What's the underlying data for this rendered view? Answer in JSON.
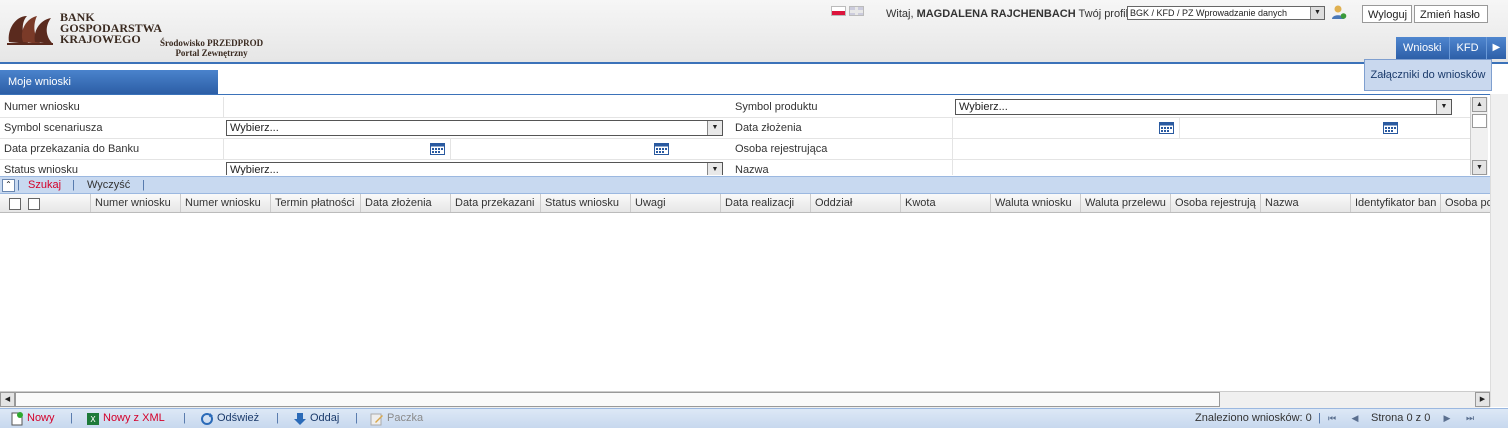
{
  "header": {
    "bank_name_lines": [
      "BANK",
      "GOSPODARSTWA",
      "KRAJOWEGO"
    ],
    "environment_lines": [
      "Środowisko PRZEDPROD",
      "Portal Zewnętrzny"
    ],
    "welcome_prefix": "Witaj,",
    "user_name": "MAGDALENA RAJCHENBACH",
    "profile_label": "Twój profil:",
    "profile_value": "BGK / KFD / PZ Wprowadzanie danych",
    "logout_label": "Wyloguj",
    "change_password_label": "Zmień hasło"
  },
  "menu": {
    "items": [
      "Wnioski",
      "KFD"
    ],
    "submenu_item": "Załączniki do wniosków"
  },
  "tab": {
    "label": "Moje wnioski"
  },
  "filters": {
    "numer_wniosku": "Numer wniosku",
    "symbol_produktu": "Symbol produktu",
    "symbol_produktu_value": "Wybierz...",
    "symbol_scenariusza": "Symbol scenariusza",
    "symbol_scenariusza_value": "Wybierz...",
    "data_zlozenia": "Data złożenia",
    "data_przekazania": "Data przekazania do Banku",
    "osoba_rejestrujaca": "Osoba rejestrująca",
    "status_wniosku": "Status wniosku",
    "status_wniosku_value": "Wybierz...",
    "nazwa": "Nazwa"
  },
  "search_bar": {
    "search": "Szukaj",
    "clear": "Wyczyść"
  },
  "grid": {
    "columns": [
      "Numer wniosku",
      "Numer wniosku",
      "Termin płatności",
      "Data złożenia",
      "Data przekazani",
      "Status wniosku",
      "Uwagi",
      "Data realizacji",
      "Oddział",
      "Kwota",
      "Waluta wniosku",
      "Waluta przelewu",
      "Osoba rejestrują",
      "Nazwa",
      "Identyfikator ban",
      "Osoba po"
    ]
  },
  "toolbar": {
    "new": "Nowy",
    "new_xml": "Nowy z XML",
    "refresh": "Odśwież",
    "submit": "Oddaj",
    "batch": "Paczka",
    "found_label": "Znaleziono wniosków: 0",
    "page_label": "Strona 0 z 0"
  },
  "icons": {
    "flags": [
      "flag-pl-icon",
      "flag-gb-icon"
    ],
    "profile": "user-icon",
    "calendar": "calendar-icon"
  },
  "colors": {
    "accent": "#2c5ea6",
    "toolbar": "#c7d8ee",
    "alert_text": "#d4002a"
  }
}
